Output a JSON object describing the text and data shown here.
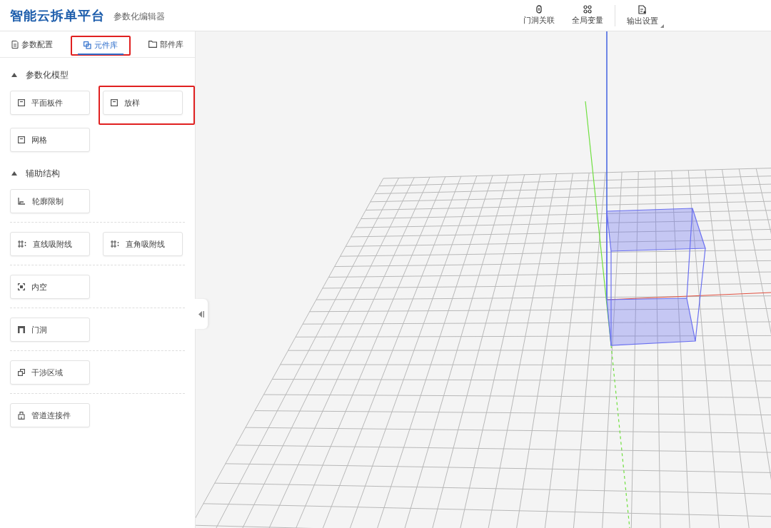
{
  "header": {
    "title": "智能云拆单平台",
    "subtitle": "参数化编辑器",
    "toolbar": [
      {
        "label": "门洞关联",
        "dropdown": false
      },
      {
        "label": "全局变量",
        "dropdown": false
      },
      {
        "label": "输出设置",
        "dropdown": true
      }
    ]
  },
  "tabs": [
    {
      "label": "参数配置",
      "selected": false,
      "highlighted": false
    },
    {
      "label": "元件库",
      "selected": true,
      "highlighted": true
    },
    {
      "label": "部件库",
      "selected": false,
      "highlighted": false
    }
  ],
  "sections": [
    {
      "title": "参数化模型",
      "expanded": true,
      "groups": [
        [
          {
            "label": "平面板件",
            "highlighted": false
          },
          {
            "label": "放样",
            "highlighted": true
          },
          {
            "label": "网格",
            "highlighted": false
          }
        ]
      ]
    },
    {
      "title": "辅助结构",
      "expanded": true,
      "groups": [
        [
          {
            "label": "轮廓限制",
            "highlighted": false
          }
        ],
        [
          {
            "label": "直线吸附线",
            "highlighted": false
          },
          {
            "label": "直角吸附线",
            "highlighted": false
          }
        ],
        [
          {
            "label": "内空",
            "highlighted": false
          }
        ],
        [
          {
            "label": "门洞",
            "highlighted": false
          }
        ],
        [
          {
            "label": "干涉区域",
            "highlighted": false
          }
        ],
        [
          {
            "label": "管道连接件",
            "highlighted": false
          }
        ]
      ]
    }
  ],
  "viewport": {
    "kind": "scene"
  }
}
